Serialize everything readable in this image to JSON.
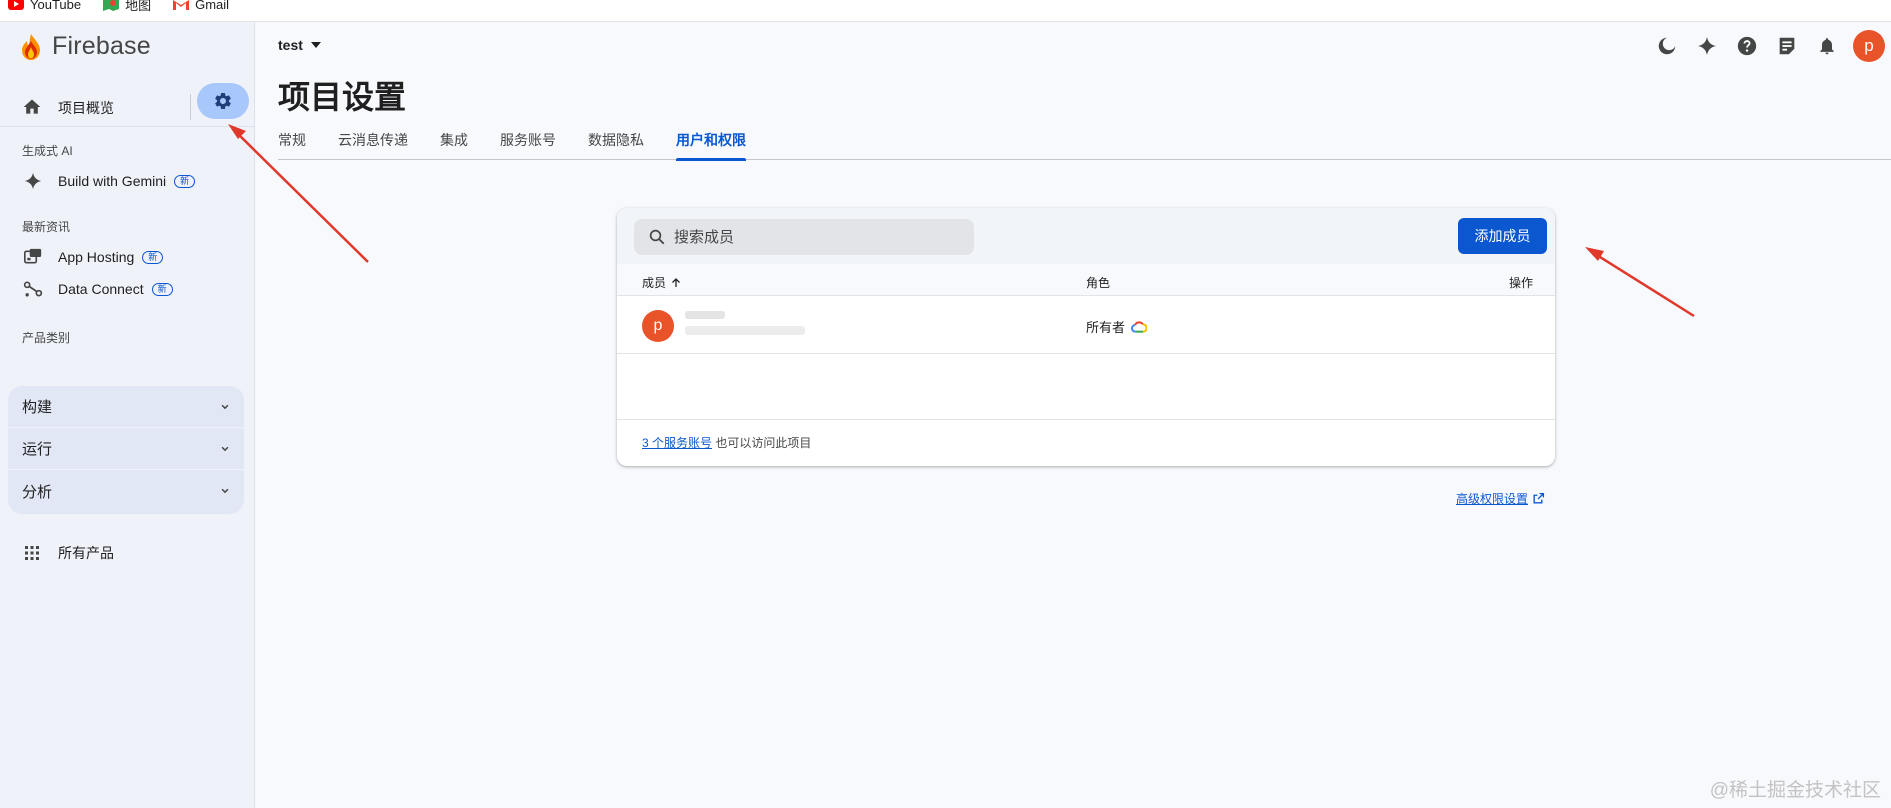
{
  "bookmarks": [
    {
      "label": "YouTube",
      "icon": "youtube-icon"
    },
    {
      "label": "地图",
      "icon": "maps-icon"
    },
    {
      "label": "Gmail",
      "icon": "gmail-icon"
    }
  ],
  "sidebar": {
    "brand": "Firebase",
    "overview_label": "项目概览",
    "sections": {
      "genai": "生成式 AI",
      "news": "最新资讯",
      "categories": "产品类别"
    },
    "items": {
      "gemini": {
        "label": "Build with Gemini",
        "badge": "新"
      },
      "hosting": {
        "label": "App Hosting",
        "badge": "新"
      },
      "dataconnect": {
        "label": "Data Connect",
        "badge": "新"
      }
    },
    "categories": [
      {
        "label": "构建"
      },
      {
        "label": "运行"
      },
      {
        "label": "分析"
      }
    ],
    "all_products": "所有产品"
  },
  "header": {
    "project": "test",
    "avatar_letter": "p"
  },
  "page": {
    "title": "项目设置",
    "tabs": [
      {
        "label": "常规",
        "active": false
      },
      {
        "label": "云消息传递",
        "active": false
      },
      {
        "label": "集成",
        "active": false
      },
      {
        "label": "服务账号",
        "active": false
      },
      {
        "label": "数据隐私",
        "active": false
      },
      {
        "label": "用户和权限",
        "active": true
      }
    ]
  },
  "members": {
    "search_placeholder": "搜索成员",
    "add_button": "添加成员",
    "columns": {
      "member": "成员",
      "role": "角色",
      "actions": "操作"
    },
    "rows": [
      {
        "avatar_letter": "p",
        "role": "所有者"
      }
    ],
    "footer_link": "3 个服务账号",
    "footer_text": " 也可以访问此项目",
    "advanced_link": "高级权限设置"
  },
  "watermark": "@稀土掘金技术社区",
  "colors": {
    "accent": "#0b57d0",
    "gear_highlight": "#a8c7fa",
    "avatar": "#e8532a",
    "annotation_arrow": "#e0382a"
  }
}
